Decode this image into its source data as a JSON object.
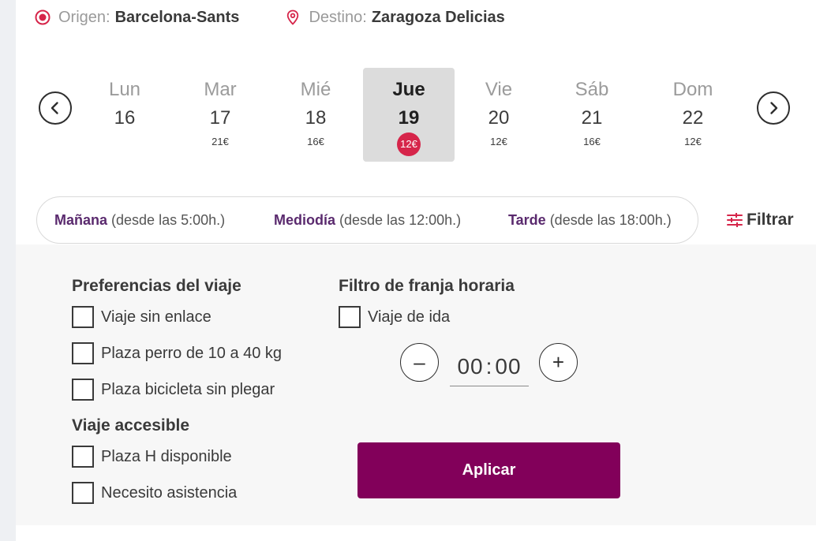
{
  "route": {
    "origin_label": "Origen:",
    "origin_value": "Barcelona-Sants",
    "destination_label": "Destino:",
    "destination_value": "Zaragoza Delicias",
    "origin_icon": "radio-dot-icon",
    "destination_icon": "map-pin-icon"
  },
  "date_strip": {
    "prev_icon": "chevron-left-circle-icon",
    "next_icon": "chevron-right-circle-icon",
    "days": [
      {
        "name": "Lun",
        "number": "16",
        "price": ""
      },
      {
        "name": "Mar",
        "number": "17",
        "price": "21€"
      },
      {
        "name": "Mié",
        "number": "18",
        "price": "16€"
      },
      {
        "name": "Jue",
        "number": "19",
        "price": "12€",
        "selected": true
      },
      {
        "name": "Vie",
        "number": "20",
        "price": "12€"
      },
      {
        "name": "Sáb",
        "number": "21",
        "price": "16€"
      },
      {
        "name": "Dom",
        "number": "22",
        "price": "12€"
      }
    ]
  },
  "time_slots": [
    {
      "name": "Mañana",
      "desc": " (desde las 5:00h.)"
    },
    {
      "name": "Mediodía",
      "desc": " (desde las 12:00h.)"
    },
    {
      "name": "Tarde",
      "desc": " (desde las 18:00h.)"
    }
  ],
  "filter_button": {
    "label": "Filtrar",
    "icon": "sliders-icon"
  },
  "filters": {
    "preferences_title": "Preferencias del viaje",
    "preferences": [
      {
        "label": "Viaje sin enlace",
        "checked": false
      },
      {
        "label": "Plaza perro de 10 a 40 kg",
        "checked": false
      },
      {
        "label": "Plaza bicicleta sin plegar",
        "checked": false
      }
    ],
    "accessible_title": "Viaje accesible",
    "accessible": [
      {
        "label": "Plaza H disponible",
        "checked": false
      },
      {
        "label": "Necesito asistencia",
        "checked": false
      }
    ],
    "time_filter_title": "Filtro de franja horaria",
    "time_filter_option": {
      "label": "Viaje de ida",
      "checked": false
    },
    "minus_label": "–",
    "plus_label": "+",
    "hours": "00",
    "separator": ":",
    "minutes": "00",
    "apply_label": "Aplicar"
  },
  "colors": {
    "brand_purple": "#82005a",
    "accent_red": "#d6254a",
    "slot_purple": "#5a2a6e"
  }
}
